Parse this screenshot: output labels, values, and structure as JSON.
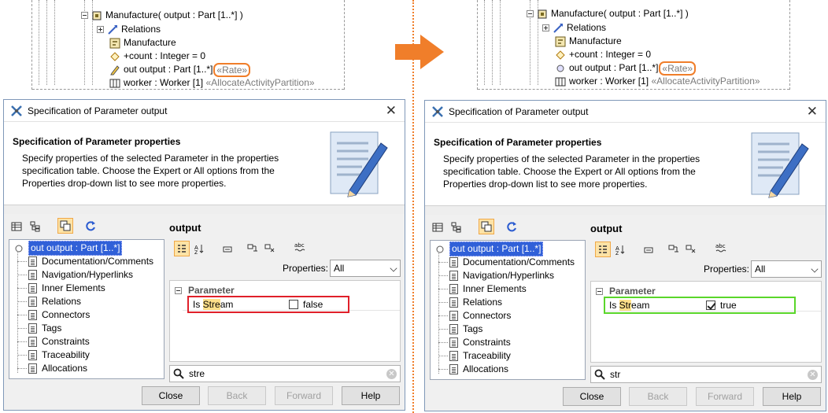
{
  "before": {
    "tree": {
      "operation": "Manufacture( output : Part [1..*] )",
      "relations": "Relations",
      "manufacture": "Manufacture",
      "count": "+count : Integer = 0",
      "output_prefix": "out output : Part [1..*]",
      "output_stereo": "«Rate»",
      "worker": "worker : Worker [1]",
      "worker_stereo": "«AllocateActivityPartition»"
    },
    "dialog": {
      "title": "Specification of Parameter output",
      "heading": "Specification of Parameter properties",
      "description": "Specify properties of the selected Parameter in the properties specification table. Choose the Expert or All options from the Properties drop-down list to see more properties.",
      "panel_title": "output",
      "properties_label": "Properties:",
      "properties_value": "All",
      "group": "Parameter",
      "prop_name_pre": "Is ",
      "prop_name_hl": "Stre",
      "prop_name_post": "am",
      "prop_value": "false",
      "prop_checked": false,
      "highlight_color": "#e0202a",
      "search_value": "stre",
      "tree_items": [
        "out output : Part [1..*]",
        "Documentation/Comments",
        "Navigation/Hyperlinks",
        "Inner Elements",
        "Relations",
        "Connectors",
        "Tags",
        "Constraints",
        "Traceability",
        "Allocations"
      ],
      "buttons": {
        "close": "Close",
        "back": "Back",
        "forward": "Forward",
        "help": "Help"
      }
    }
  },
  "after": {
    "tree": {
      "operation": "Manufacture( output : Part [1..*] )",
      "relations": "Relations",
      "manufacture": "Manufacture",
      "count": "+count : Integer = 0",
      "output_prefix": "out output : Part [1..*]",
      "output_stereo": "«Rate»",
      "worker": "worker : Worker [1]",
      "worker_stereo": "«AllocateActivityPartition»"
    },
    "dialog": {
      "title": "Specification of Parameter output",
      "heading": "Specification of Parameter properties",
      "description": "Specify properties of the selected Parameter in the properties specification table. Choose the Expert or All options from the Properties drop-down list to see more properties.",
      "panel_title": "output",
      "properties_label": "Properties:",
      "properties_value": "All",
      "group": "Parameter",
      "prop_name_pre": "Is ",
      "prop_name_hl": "Str",
      "prop_name_post": "eam",
      "prop_value": "true",
      "prop_checked": true,
      "highlight_color": "#5ad62a",
      "search_value": "str",
      "tree_items": [
        "out output : Part [1..*]",
        "Documentation/Comments",
        "Navigation/Hyperlinks",
        "Inner Elements",
        "Relations",
        "Connectors",
        "Tags",
        "Constraints",
        "Traceability",
        "Allocations"
      ],
      "buttons": {
        "close": "Close",
        "back": "Back",
        "forward": "Forward",
        "help": "Help"
      }
    }
  },
  "colors": {
    "accent_orange": "#f07e2a",
    "selection_blue": "#3060d8"
  }
}
